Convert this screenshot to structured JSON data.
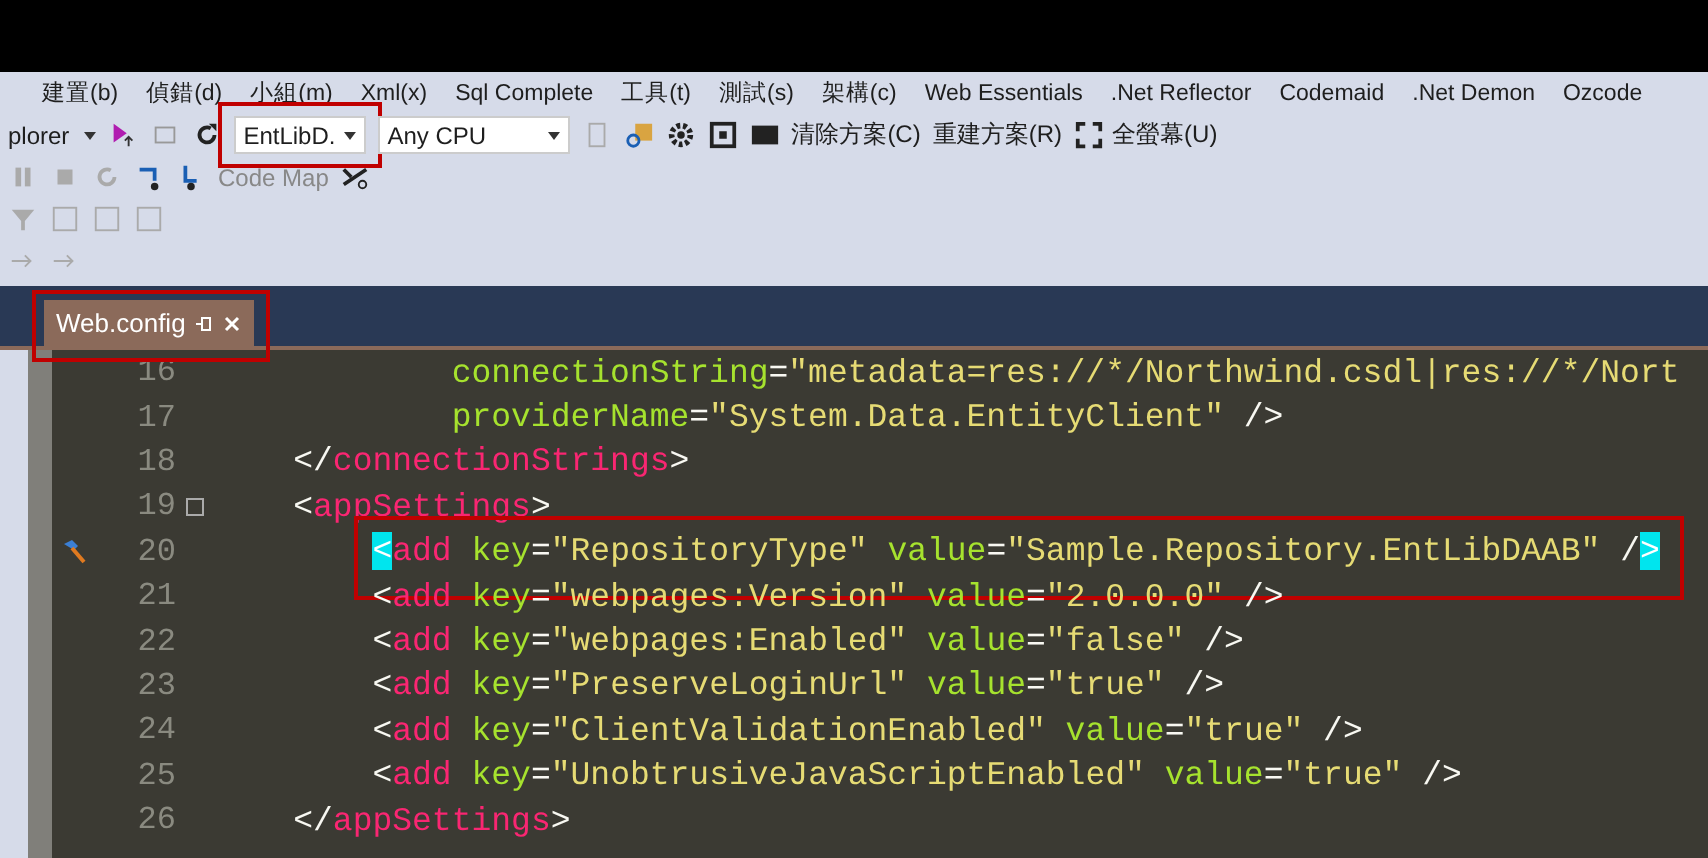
{
  "menu": [
    "建置(b)",
    "偵錯(d)",
    "小組(m)",
    "Xml(x)",
    "Sql Complete",
    "工具(t)",
    "測試(s)",
    "架構(c)",
    "Web Essentials",
    ".Net Reflector",
    "Codemaid",
    ".Net Demon",
    "Ozcode"
  ],
  "toolbar": {
    "startup_project": "plorer",
    "configuration": {
      "value": "EntLibD.",
      "annotated": true
    },
    "platform": {
      "value": "Any CPU"
    },
    "clean_solution": "清除方案(C)",
    "rebuild_solution": "重建方案(R)",
    "full_screen": "全螢幕(U)",
    "code_map": "Code Map"
  },
  "tabs": [
    {
      "label": "Web.config",
      "selected": true,
      "annotated": true
    }
  ],
  "editor": {
    "lines": [
      {
        "number": "16",
        "marker": false,
        "foldable": false,
        "annotated": false,
        "tokens": [
          {
            "kind": "attr",
            "text": "            connectionString"
          },
          {
            "kind": "punct",
            "text": "="
          },
          {
            "kind": "string",
            "text": "\"metadata=res://*/Northwind.csdl|res://*/Nort"
          }
        ]
      },
      {
        "number": "17",
        "marker": false,
        "foldable": false,
        "annotated": false,
        "tokens": [
          {
            "kind": "attr",
            "text": "            providerName"
          },
          {
            "kind": "punct",
            "text": "="
          },
          {
            "kind": "string",
            "text": "\"System.Data.EntityClient\""
          },
          {
            "kind": "punct",
            "text": " />"
          }
        ]
      },
      {
        "number": "18",
        "marker": false,
        "foldable": false,
        "annotated": false,
        "tokens": [
          {
            "kind": "punct",
            "text": "    </"
          },
          {
            "kind": "tag",
            "text": "connectionStrings"
          },
          {
            "kind": "punct",
            "text": ">"
          }
        ]
      },
      {
        "number": "19",
        "marker": false,
        "foldable": true,
        "annotated": false,
        "tokens": [
          {
            "kind": "punct",
            "text": "    <"
          },
          {
            "kind": "tag",
            "text": "appSettings"
          },
          {
            "kind": "punct",
            "text": ">"
          }
        ]
      },
      {
        "number": "20",
        "marker": true,
        "foldable": false,
        "annotated": true,
        "tokens": [
          {
            "kind": "match",
            "text": "        <"
          },
          {
            "kind": "tag",
            "text": "add"
          },
          {
            "kind": "attr",
            "text": " key"
          },
          {
            "kind": "punct",
            "text": "="
          },
          {
            "kind": "string",
            "text": "\"RepositoryType\""
          },
          {
            "kind": "attr",
            "text": " value"
          },
          {
            "kind": "punct",
            "text": "="
          },
          {
            "kind": "string",
            "text": "\"Sample.Repository.EntLibDAAB\""
          },
          {
            "kind": "punct",
            "text": " /"
          },
          {
            "kind": "match",
            "text": ">"
          }
        ]
      },
      {
        "number": "21",
        "marker": false,
        "foldable": false,
        "annotated": false,
        "tokens": [
          {
            "kind": "punct",
            "text": "        <"
          },
          {
            "kind": "tag",
            "text": "add"
          },
          {
            "kind": "attr",
            "text": " key"
          },
          {
            "kind": "punct",
            "text": "="
          },
          {
            "kind": "string",
            "text": "\"webpages:Version\""
          },
          {
            "kind": "attr",
            "text": " value"
          },
          {
            "kind": "punct",
            "text": "="
          },
          {
            "kind": "string",
            "text": "\"2.0.0.0\""
          },
          {
            "kind": "punct",
            "text": " />"
          }
        ]
      },
      {
        "number": "22",
        "marker": false,
        "foldable": false,
        "annotated": false,
        "tokens": [
          {
            "kind": "punct",
            "text": "        <"
          },
          {
            "kind": "tag",
            "text": "add"
          },
          {
            "kind": "attr",
            "text": " key"
          },
          {
            "kind": "punct",
            "text": "="
          },
          {
            "kind": "string",
            "text": "\"webpages:Enabled\""
          },
          {
            "kind": "attr",
            "text": " value"
          },
          {
            "kind": "punct",
            "text": "="
          },
          {
            "kind": "string",
            "text": "\"false\""
          },
          {
            "kind": "punct",
            "text": " />"
          }
        ]
      },
      {
        "number": "23",
        "marker": false,
        "foldable": false,
        "annotated": false,
        "tokens": [
          {
            "kind": "punct",
            "text": "        <"
          },
          {
            "kind": "tag",
            "text": "add"
          },
          {
            "kind": "attr",
            "text": " key"
          },
          {
            "kind": "punct",
            "text": "="
          },
          {
            "kind": "string",
            "text": "\"PreserveLoginUrl\""
          },
          {
            "kind": "attr",
            "text": " value"
          },
          {
            "kind": "punct",
            "text": "="
          },
          {
            "kind": "string",
            "text": "\"true\""
          },
          {
            "kind": "punct",
            "text": " />"
          }
        ]
      },
      {
        "number": "24",
        "marker": false,
        "foldable": false,
        "annotated": false,
        "tokens": [
          {
            "kind": "punct",
            "text": "        <"
          },
          {
            "kind": "tag",
            "text": "add"
          },
          {
            "kind": "attr",
            "text": " key"
          },
          {
            "kind": "punct",
            "text": "="
          },
          {
            "kind": "string",
            "text": "\"ClientValidationEnabled\""
          },
          {
            "kind": "attr",
            "text": " value"
          },
          {
            "kind": "punct",
            "text": "="
          },
          {
            "kind": "string",
            "text": "\"true\""
          },
          {
            "kind": "punct",
            "text": " />"
          }
        ]
      },
      {
        "number": "25",
        "marker": false,
        "foldable": false,
        "annotated": false,
        "tokens": [
          {
            "kind": "punct",
            "text": "        <"
          },
          {
            "kind": "tag",
            "text": "add"
          },
          {
            "kind": "attr",
            "text": " key"
          },
          {
            "kind": "punct",
            "text": "="
          },
          {
            "kind": "string",
            "text": "\"UnobtrusiveJavaScriptEnabled\""
          },
          {
            "kind": "attr",
            "text": " value"
          },
          {
            "kind": "punct",
            "text": "="
          },
          {
            "kind": "string",
            "text": "\"true\""
          },
          {
            "kind": "punct",
            "text": " />"
          }
        ]
      },
      {
        "number": "26",
        "marker": false,
        "foldable": false,
        "annotated": false,
        "tokens": [
          {
            "kind": "punct",
            "text": "    </"
          },
          {
            "kind": "tag",
            "text": "appSettings"
          },
          {
            "kind": "punct",
            "text": ">"
          }
        ]
      }
    ]
  }
}
